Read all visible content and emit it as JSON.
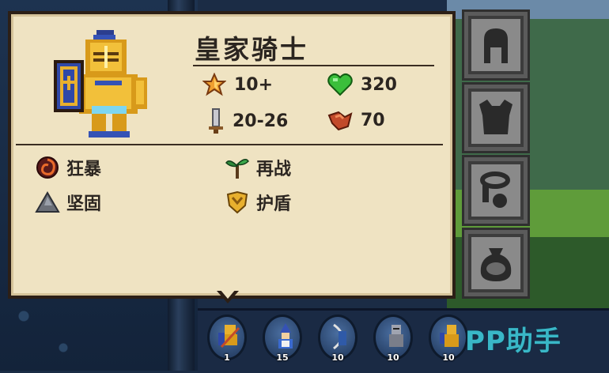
{
  "unit": {
    "name": "皇家骑士",
    "stats": {
      "rank": "10+",
      "health": "320",
      "damage": "20-26",
      "armor": "70"
    },
    "skills": [
      {
        "label": "狂暴",
        "icon": "frenzy-icon"
      },
      {
        "label": "再战",
        "icon": "revive-icon"
      },
      {
        "label": "坚固",
        "icon": "sturdy-icon"
      },
      {
        "label": "护盾",
        "icon": "shield-icon"
      }
    ]
  },
  "equipment_slots": [
    "helmet-slot",
    "armor-slot",
    "ring-slot",
    "bag-slot"
  ],
  "tray": {
    "units": [
      {
        "count": "1",
        "icon": "royal-knight-icon"
      },
      {
        "count": "15",
        "icon": "mage-icon"
      },
      {
        "count": "10",
        "icon": "archer-icon"
      },
      {
        "count": "10",
        "icon": "soldier-icon"
      },
      {
        "count": "10",
        "icon": "knight-icon"
      }
    ]
  },
  "watermark": "PP助手",
  "colors": {
    "panel_bg": "#efe3c2",
    "panel_border": "#2c1f16",
    "text": "#2b2520",
    "watermark": "#3dc7d6"
  }
}
